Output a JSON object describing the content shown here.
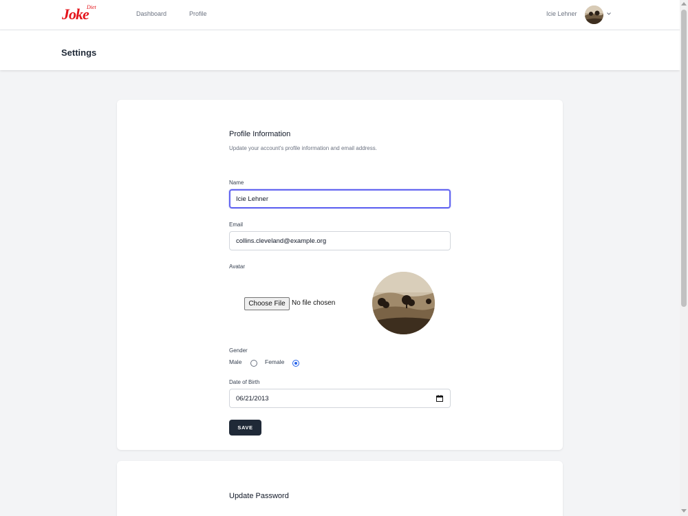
{
  "nav": {
    "logo_main": "Joke",
    "logo_sup": "Diet",
    "links": [
      {
        "label": "Dashboard"
      },
      {
        "label": "Profile"
      }
    ],
    "user_name": "Icie Lehner",
    "avatar_icon": "landscape-photo",
    "caret_icon": "chevron-down-icon"
  },
  "header": {
    "title": "Settings"
  },
  "profile": {
    "title": "Profile Information",
    "description": "Update your account's profile information and email address.",
    "name_label": "Name",
    "name_value": "Icie Lehner",
    "email_label": "Email",
    "email_value": "collins.cleveland@example.org",
    "avatar_label": "Avatar",
    "file_button": "Choose File",
    "file_status": "No file chosen",
    "gender_label": "Gender",
    "gender_options": [
      {
        "label": "Male",
        "checked": false
      },
      {
        "label": "Female",
        "checked": true
      }
    ],
    "dob_label": "Date of Birth",
    "dob_value": "06/21/2013",
    "save_label": "SAVE"
  },
  "password": {
    "title": "Update Password"
  },
  "colors": {
    "accent_focus": "#6366f1",
    "button_dark": "#1f2937",
    "radio_checked": "#2563eb",
    "logo_red": "#e4141b"
  }
}
